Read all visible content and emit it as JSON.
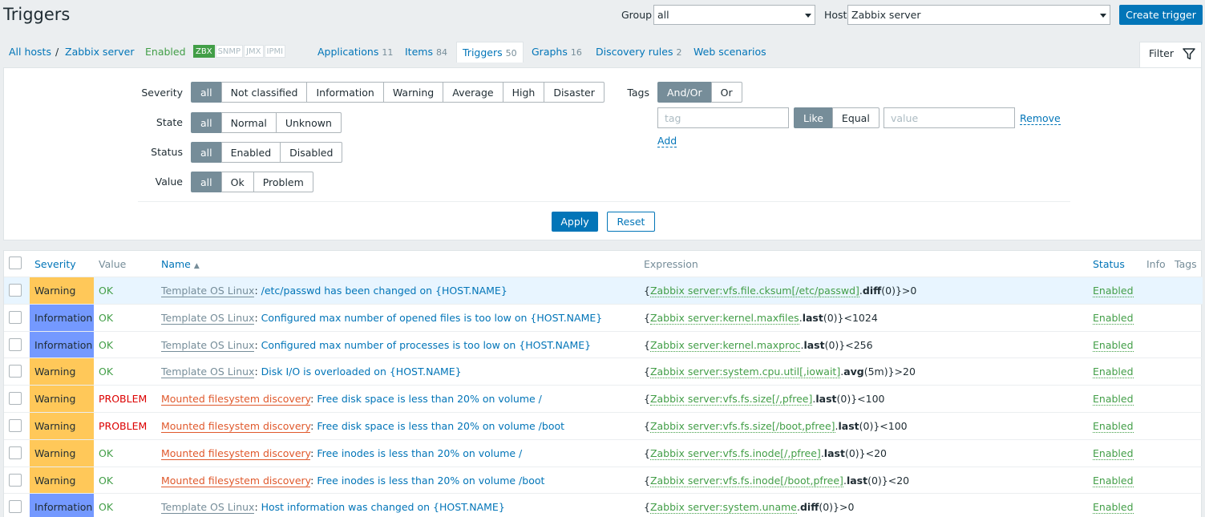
{
  "header": {
    "title": "Triggers",
    "group_label": "Group",
    "group_value": "all",
    "host_label": "Host",
    "host_value": "Zabbix server",
    "create_button": "Create trigger"
  },
  "nav": {
    "all_hosts": "All hosts",
    "separator": "/",
    "host": "Zabbix server",
    "enabled": "Enabled",
    "badges": [
      {
        "label": "ZBX",
        "active": true
      },
      {
        "label": "SNMP",
        "active": false
      },
      {
        "label": "JMX",
        "active": false
      },
      {
        "label": "IPMI",
        "active": false
      }
    ],
    "applications": {
      "label": "Applications",
      "count": "11"
    },
    "items": {
      "label": "Items",
      "count": "84"
    },
    "triggers": {
      "label": "Triggers",
      "count": "50"
    },
    "graphs": {
      "label": "Graphs",
      "count": "16"
    },
    "discovery": {
      "label": "Discovery rules",
      "count": "2"
    },
    "web": {
      "label": "Web scenarios"
    }
  },
  "filter": {
    "tab_label": "Filter",
    "severity_label": "Severity",
    "severity_options": [
      "all",
      "Not classified",
      "Information",
      "Warning",
      "Average",
      "High",
      "Disaster"
    ],
    "state_label": "State",
    "state_options": [
      "all",
      "Normal",
      "Unknown"
    ],
    "status_label": "Status",
    "status_options": [
      "all",
      "Enabled",
      "Disabled"
    ],
    "value_label": "Value",
    "value_options": [
      "all",
      "Ok",
      "Problem"
    ],
    "tags_label": "Tags",
    "tags_options": [
      "And/Or",
      "Or"
    ],
    "tag_placeholder": "tag",
    "match_options": [
      "Like",
      "Equal"
    ],
    "value_placeholder": "value",
    "remove_label": "Remove",
    "add_label": "Add",
    "apply_label": "Apply",
    "reset_label": "Reset"
  },
  "table": {
    "columns": {
      "severity": "Severity",
      "value": "Value",
      "name": "Name",
      "name_sort_arrow": "▲",
      "expression": "Expression",
      "status": "Status",
      "info": "Info",
      "tags": "Tags"
    },
    "rows": [
      {
        "severity": "Warning",
        "sev_color": "#ffc859",
        "value": "OK",
        "prefix": "Template OS Linux",
        "prefix_type": "template",
        "name": "/etc/passwd has been changed on {HOST.NAME}",
        "ex_open": "{",
        "ex_item": "Zabbix server:vfs.file.cksum[/etc/passwd]",
        "ex_dot": ".",
        "ex_fn": "diff",
        "ex_rest": "(0)}>0",
        "status": "Enabled",
        "highlight": true
      },
      {
        "severity": "Information",
        "sev_color": "#7499ff",
        "value": "OK",
        "prefix": "Template OS Linux",
        "prefix_type": "template",
        "name": "Configured max number of opened files is too low on {HOST.NAME}",
        "ex_open": "{",
        "ex_item": "Zabbix server:kernel.maxfiles",
        "ex_dot": ".",
        "ex_fn": "last",
        "ex_rest": "(0)}<1024",
        "status": "Enabled",
        "highlight": false
      },
      {
        "severity": "Information",
        "sev_color": "#7499ff",
        "value": "OK",
        "prefix": "Template OS Linux",
        "prefix_type": "template",
        "name": "Configured max number of processes is too low on {HOST.NAME}",
        "ex_open": "{",
        "ex_item": "Zabbix server:kernel.maxproc",
        "ex_dot": ".",
        "ex_fn": "last",
        "ex_rest": "(0)}<256",
        "status": "Enabled",
        "highlight": false
      },
      {
        "severity": "Warning",
        "sev_color": "#ffc859",
        "value": "OK",
        "prefix": "Template OS Linux",
        "prefix_type": "template",
        "name": "Disk I/O is overloaded on {HOST.NAME}",
        "ex_open": "{",
        "ex_item": "Zabbix server:system.cpu.util[,iowait]",
        "ex_dot": ".",
        "ex_fn": "avg",
        "ex_rest": "(5m)}>20",
        "status": "Enabled",
        "highlight": false
      },
      {
        "severity": "Warning",
        "sev_color": "#ffc859",
        "value": "PROBLEM",
        "prefix": "Mounted filesystem discovery",
        "prefix_type": "discovery",
        "name": "Free disk space is less than 20% on volume /",
        "ex_open": "{",
        "ex_item": "Zabbix server:vfs.fs.size[/,pfree]",
        "ex_dot": ".",
        "ex_fn": "last",
        "ex_rest": "(0)}<100",
        "status": "Enabled",
        "highlight": false
      },
      {
        "severity": "Warning",
        "sev_color": "#ffc859",
        "value": "PROBLEM",
        "prefix": "Mounted filesystem discovery",
        "prefix_type": "discovery",
        "name": "Free disk space is less than 20% on volume /boot",
        "ex_open": "{",
        "ex_item": "Zabbix server:vfs.fs.size[/boot,pfree]",
        "ex_dot": ".",
        "ex_fn": "last",
        "ex_rest": "(0)}<100",
        "status": "Enabled",
        "highlight": false
      },
      {
        "severity": "Warning",
        "sev_color": "#ffc859",
        "value": "OK",
        "prefix": "Mounted filesystem discovery",
        "prefix_type": "discovery",
        "name": "Free inodes is less than 20% on volume /",
        "ex_open": "{",
        "ex_item": "Zabbix server:vfs.fs.inode[/,pfree]",
        "ex_dot": ".",
        "ex_fn": "last",
        "ex_rest": "(0)}<20",
        "status": "Enabled",
        "highlight": false
      },
      {
        "severity": "Warning",
        "sev_color": "#ffc859",
        "value": "OK",
        "prefix": "Mounted filesystem discovery",
        "prefix_type": "discovery",
        "name": "Free inodes is less than 20% on volume /boot",
        "ex_open": "{",
        "ex_item": "Zabbix server:vfs.fs.inode[/boot,pfree]",
        "ex_dot": ".",
        "ex_fn": "last",
        "ex_rest": "(0)}<20",
        "status": "Enabled",
        "highlight": false
      },
      {
        "severity": "Information",
        "sev_color": "#7499ff",
        "value": "OK",
        "prefix": "Template OS Linux",
        "prefix_type": "template",
        "name": "Host information was changed on {HOST.NAME}",
        "ex_open": "{",
        "ex_item": "Zabbix server:system.uname",
        "ex_dot": ".",
        "ex_fn": "diff",
        "ex_rest": "(0)}>0",
        "status": "Enabled",
        "highlight": false
      }
    ]
  }
}
